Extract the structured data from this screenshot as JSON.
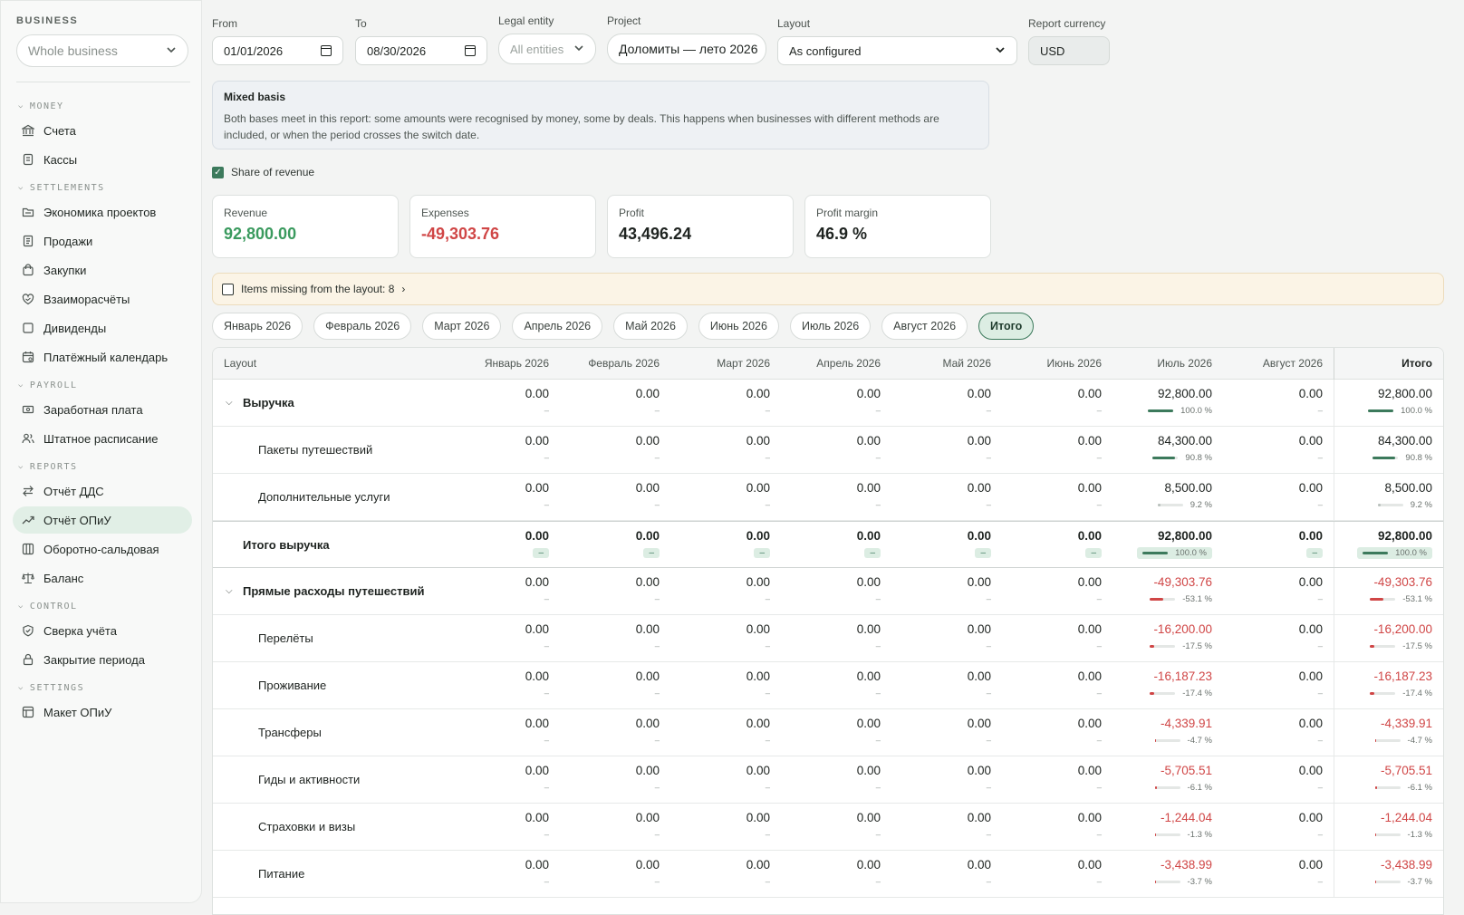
{
  "sidebar": {
    "business_label": "BUSINESS",
    "business_select": "Whole business",
    "sections": [
      {
        "title": "MONEY",
        "items": [
          {
            "label": "Счета",
            "icon": "bank-icon"
          },
          {
            "label": "Кассы",
            "icon": "cashbox-icon"
          }
        ]
      },
      {
        "title": "SETTLEMENTS",
        "items": [
          {
            "label": "Экономика проектов",
            "icon": "folder-icon"
          },
          {
            "label": "Продажи",
            "icon": "receipt-icon"
          },
          {
            "label": "Закупки",
            "icon": "bag-icon"
          },
          {
            "label": "Взаиморасчёты",
            "icon": "handshake-icon"
          },
          {
            "label": "Дивиденды",
            "icon": "square-icon"
          },
          {
            "label": "Платёжный календарь",
            "icon": "calendar-icon"
          }
        ]
      },
      {
        "title": "PAYROLL",
        "items": [
          {
            "label": "Заработная плата",
            "icon": "money-icon"
          },
          {
            "label": "Штатное расписание",
            "icon": "people-icon"
          }
        ]
      },
      {
        "title": "REPORTS",
        "items": [
          {
            "label": "Отчёт ДДС",
            "icon": "swap-icon"
          },
          {
            "label": "Отчёт ОПиУ",
            "icon": "trend-icon",
            "active": true
          },
          {
            "label": "Оборотно-сальдовая",
            "icon": "columns-icon"
          },
          {
            "label": "Баланс",
            "icon": "scale-icon"
          }
        ]
      },
      {
        "title": "CONTROL",
        "items": [
          {
            "label": "Сверка учёта",
            "icon": "shield-check-icon"
          },
          {
            "label": "Закрытие периода",
            "icon": "lock-icon"
          }
        ]
      },
      {
        "title": "SETTINGS",
        "items": [
          {
            "label": "Макет ОПиУ",
            "icon": "table-icon"
          }
        ]
      }
    ]
  },
  "filters": {
    "from_label": "From",
    "from_value": "01/01/2026",
    "to_label": "To",
    "to_value": "08/30/2026",
    "legal_label": "Legal entity",
    "legal_value": "All entities",
    "project_label": "Project",
    "project_value": "Доломиты — лето 2026",
    "layout_label": "Layout",
    "layout_value": "As configured",
    "currency_label": "Report currency",
    "currency_value": "USD"
  },
  "notice": {
    "title": "Mixed basis",
    "body": "Both bases meet in this report: some amounts were recognised by money, some by deals. This happens when businesses with different methods are included, or when the period crosses the switch date."
  },
  "share_label": "Share of revenue",
  "kpis": {
    "revenue_label": "Revenue",
    "revenue_value": "92,800.00",
    "expenses_label": "Expenses",
    "expenses_value": "-49,303.76",
    "profit_label": "Profit",
    "profit_value": "43,496.24",
    "margin_label": "Profit margin",
    "margin_value": "46.9 %"
  },
  "missing_label": "Items missing from the layout: 8",
  "tabs": [
    "Январь 2026",
    "Февраль 2026",
    "Март 2026",
    "Апрель 2026",
    "Май 2026",
    "Июнь 2026",
    "Июль 2026",
    "Август 2026",
    "Итого"
  ],
  "active_tab": 8,
  "table": {
    "layout_header": "Layout",
    "columns": [
      "Январь 2026",
      "Февраль 2026",
      "Март 2026",
      "Апрель 2026",
      "Май 2026",
      "Июнь 2026",
      "Июль 2026",
      "Август 2026",
      "Итого"
    ],
    "zero": "0.00",
    "dash": "–",
    "rows": [
      {
        "name": "Выручка",
        "kind": "group",
        "jul": "92,800.00",
        "total": "92,800.00",
        "pct": "100.0 %",
        "share": 1.0,
        "neg": false
      },
      {
        "name": "Пакеты путешествий",
        "kind": "child",
        "jul": "84,300.00",
        "total": "84,300.00",
        "pct": "90.8 %",
        "share": 0.908,
        "neg": false
      },
      {
        "name": "Дополнительные услуги",
        "kind": "child",
        "jul": "8,500.00",
        "total": "8,500.00",
        "pct": "9.2 %",
        "share": 0.092,
        "neg": false
      },
      {
        "name": "Итого выручка",
        "kind": "total",
        "jul": "92,800.00",
        "total": "92,800.00",
        "pct": "100.0 %",
        "share": 1.0,
        "neg": false
      },
      {
        "name": "Прямые расходы путешествий",
        "kind": "group",
        "jul": "-49,303.76",
        "total": "-49,303.76",
        "pct": "-53.1 %",
        "share": 0.531,
        "neg": true
      },
      {
        "name": "Перелёты",
        "kind": "child",
        "jul": "-16,200.00",
        "total": "-16,200.00",
        "pct": "-17.5 %",
        "share": 0.175,
        "neg": true
      },
      {
        "name": "Проживание",
        "kind": "child",
        "jul": "-16,187.23",
        "total": "-16,187.23",
        "pct": "-17.4 %",
        "share": 0.174,
        "neg": true
      },
      {
        "name": "Трансферы",
        "kind": "child",
        "jul": "-4,339.91",
        "total": "-4,339.91",
        "pct": "-4.7 %",
        "share": 0.047,
        "neg": true
      },
      {
        "name": "Гиды и активности",
        "kind": "child",
        "jul": "-5,705.51",
        "total": "-5,705.51",
        "pct": "-6.1 %",
        "share": 0.061,
        "neg": true
      },
      {
        "name": "Страховки и визы",
        "kind": "child",
        "jul": "-1,244.04",
        "total": "-1,244.04",
        "pct": "-1.3 %",
        "share": 0.013,
        "neg": true
      },
      {
        "name": "Питание",
        "kind": "child",
        "jul": "-3,438.99",
        "total": "-3,438.99",
        "pct": "-3.7 %",
        "share": 0.037,
        "neg": true
      }
    ]
  },
  "colors": {
    "accent": "#3c7a5c",
    "positive": "#3a9a5e",
    "negative": "#d04646",
    "neg_bar": "#d04646",
    "pos_bar": "#3c7a5c",
    "small_bar": "#b8c0bc"
  }
}
